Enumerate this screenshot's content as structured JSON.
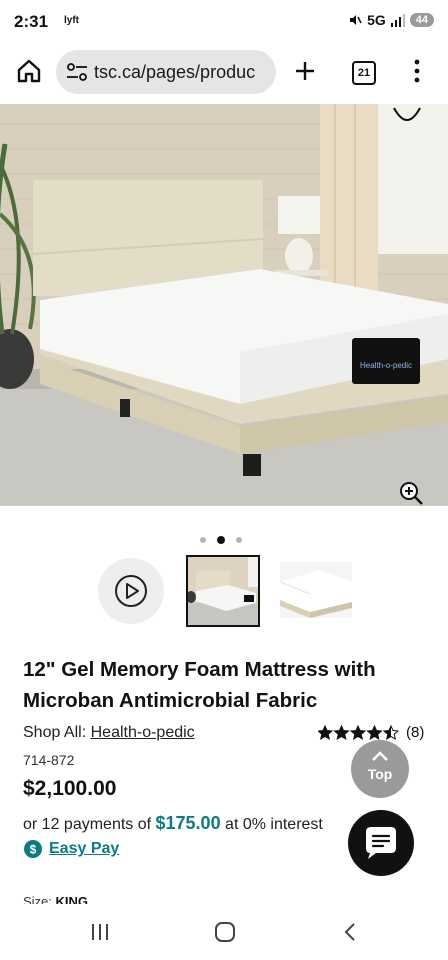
{
  "status_bar": {
    "time": "2:31",
    "carrier_icon": "lyft",
    "network": "5G",
    "battery": "44"
  },
  "browser": {
    "url": "tsc.ca/pages/produc",
    "tab_count": "21"
  },
  "gallery": {
    "image_count": 3,
    "active_index": 1,
    "brand_label": "Health-o-pedic"
  },
  "product": {
    "title": "12\" Gel Memory Foam Mattress with Microban Antimicrobial Fabric",
    "shop_all_prefix": "Shop All: ",
    "brand": "Health-o-pedic",
    "rating_value": 4.5,
    "review_count": "(8)",
    "sku": "714-872",
    "price": "$2,100.00",
    "payments_prefix": "or 12 payments of ",
    "payment_amount": "$175.00",
    "payments_suffix": " at 0% interest",
    "easy_pay_label": "Easy Pay",
    "size_label": "Size: ",
    "size_value": "KING"
  },
  "floating": {
    "top_label": "Top"
  },
  "colors": {
    "accent_teal": "#0a7c82",
    "top_button": "#9a9a9a",
    "chat_button": "#111111"
  }
}
